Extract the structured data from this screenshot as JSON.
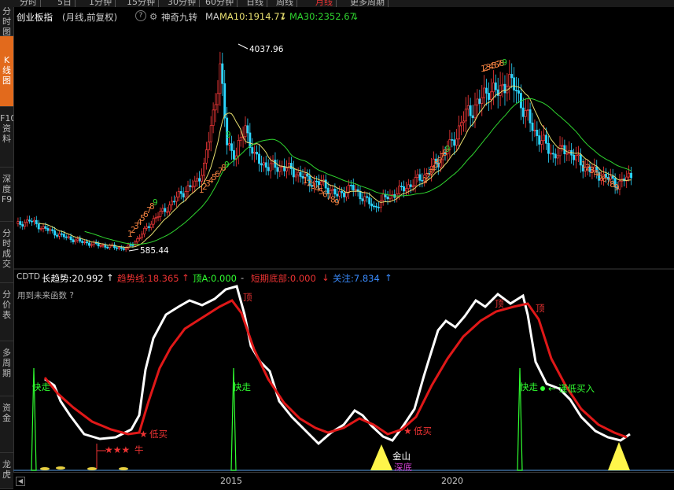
{
  "sidebar": {
    "tabs": [
      {
        "label": "分时图",
        "active": false
      },
      {
        "label": "K线图",
        "active": true
      },
      {
        "label": "F10资料",
        "active": false
      },
      {
        "label": "深度F9",
        "active": false
      },
      {
        "label": "分时成交",
        "active": false
      },
      {
        "label": "分价表",
        "active": false
      },
      {
        "label": "多周期",
        "active": false
      },
      {
        "label": "资金",
        "active": false
      },
      {
        "label": "龙虎",
        "active": false
      }
    ]
  },
  "period_tabs": [
    {
      "label": "分时",
      "active": false
    },
    {
      "label": "5日",
      "active": false
    },
    {
      "label": "1分钟",
      "active": false
    },
    {
      "label": "15分钟",
      "active": false
    },
    {
      "label": "30分钟",
      "active": false
    },
    {
      "label": "60分钟",
      "active": false
    },
    {
      "label": "日线",
      "active": false
    },
    {
      "label": "周线",
      "active": false
    },
    {
      "label": "月线",
      "active": true
    },
    {
      "label": "更多周期",
      "active": false
    }
  ],
  "chart_header": {
    "name": "创业板指",
    "mode": "(月线,前复权)",
    "help": "?",
    "tool": "神奇九转",
    "ma_label": "MA",
    "ma10": "MA10:1914.77",
    "ma30": "MA30:2352.67"
  },
  "price_annotations": {
    "high": "4037.96",
    "low": "585.44"
  },
  "indicator_header": {
    "code": "CDTD",
    "trend": "长趋势:20.992",
    "trend_line": "趋势线:18.365",
    "top_a": "顶A:0.000",
    "short_bottom": "短期底部:0.000",
    "focus": "关注:7.834",
    "note": "用到未来函数 ?"
  },
  "indicator_labels": {
    "top": "顶",
    "fast": "快走",
    "low_buy": "低买",
    "ox": "牛",
    "gold": "金山",
    "deep": "深底",
    "cautious": "谨低买入"
  },
  "x_axis": {
    "years": [
      "2015",
      "2020"
    ]
  },
  "colors": {
    "up": "#ff3b3b",
    "down": "#2bd6ff",
    "ma10": "#e8e070",
    "ma30": "#2fd42f",
    "trend": "#ffffff",
    "trendline": "#e01818",
    "signal": "#30ff30"
  },
  "chart_data": {
    "type": "candlestick",
    "series": [
      {
        "name": "MA10",
        "values": "computed"
      },
      {
        "name": "MA30",
        "values": "computed"
      }
    ],
    "key_points": {
      "high": 4037.96,
      "low": 585.44
    },
    "ylim": [
      400,
      4300
    ],
    "nine_turn_labels_up": [
      "1",
      "2",
      "3",
      "4",
      "5",
      "6",
      "7",
      "8",
      "9"
    ],
    "nine_turn_labels_down": [
      "1",
      "2",
      "3",
      "4",
      "5",
      "6",
      "7",
      "8",
      "9"
    ]
  }
}
